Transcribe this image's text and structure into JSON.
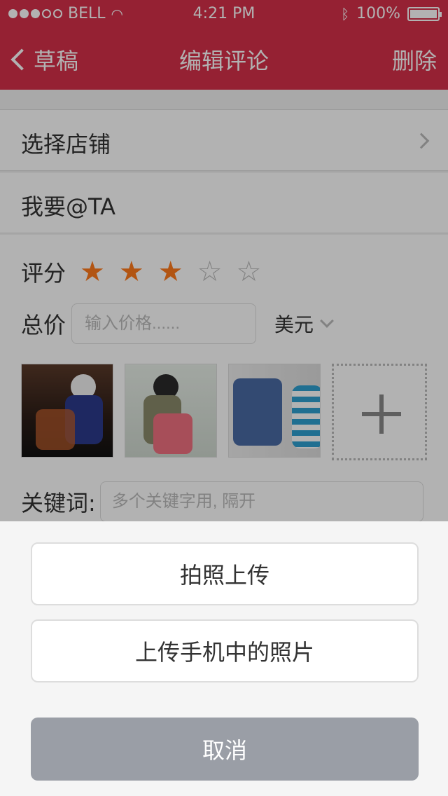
{
  "status_bar": {
    "carrier": "BELL",
    "time": "4:21 PM",
    "battery": "100%",
    "signal_dots_filled": 3,
    "signal_dots_total": 5
  },
  "nav": {
    "back_label": "草稿",
    "title": "编辑评论",
    "delete_label": "删除"
  },
  "rows": {
    "store_label": "选择店铺",
    "mention_label": "我要@TA"
  },
  "rating": {
    "label": "评分",
    "value": 3,
    "max": 5,
    "color_on": "#ff7a1c"
  },
  "price": {
    "label": "总价",
    "placeholder": "输入价格......",
    "currency": "美元"
  },
  "photos": {
    "count": 3,
    "add_icon": "plus-icon"
  },
  "keywords": {
    "label": "关键词:",
    "placeholder": "多个关键字用, 隔开"
  },
  "action_sheet": {
    "take_photo": "拍照上传",
    "upload_photo": "上传手机中的照片",
    "cancel": "取消"
  },
  "colors": {
    "brand": "#d6304a",
    "cancel_bg": "#9a9ea6",
    "star": "#ff7a1c"
  }
}
